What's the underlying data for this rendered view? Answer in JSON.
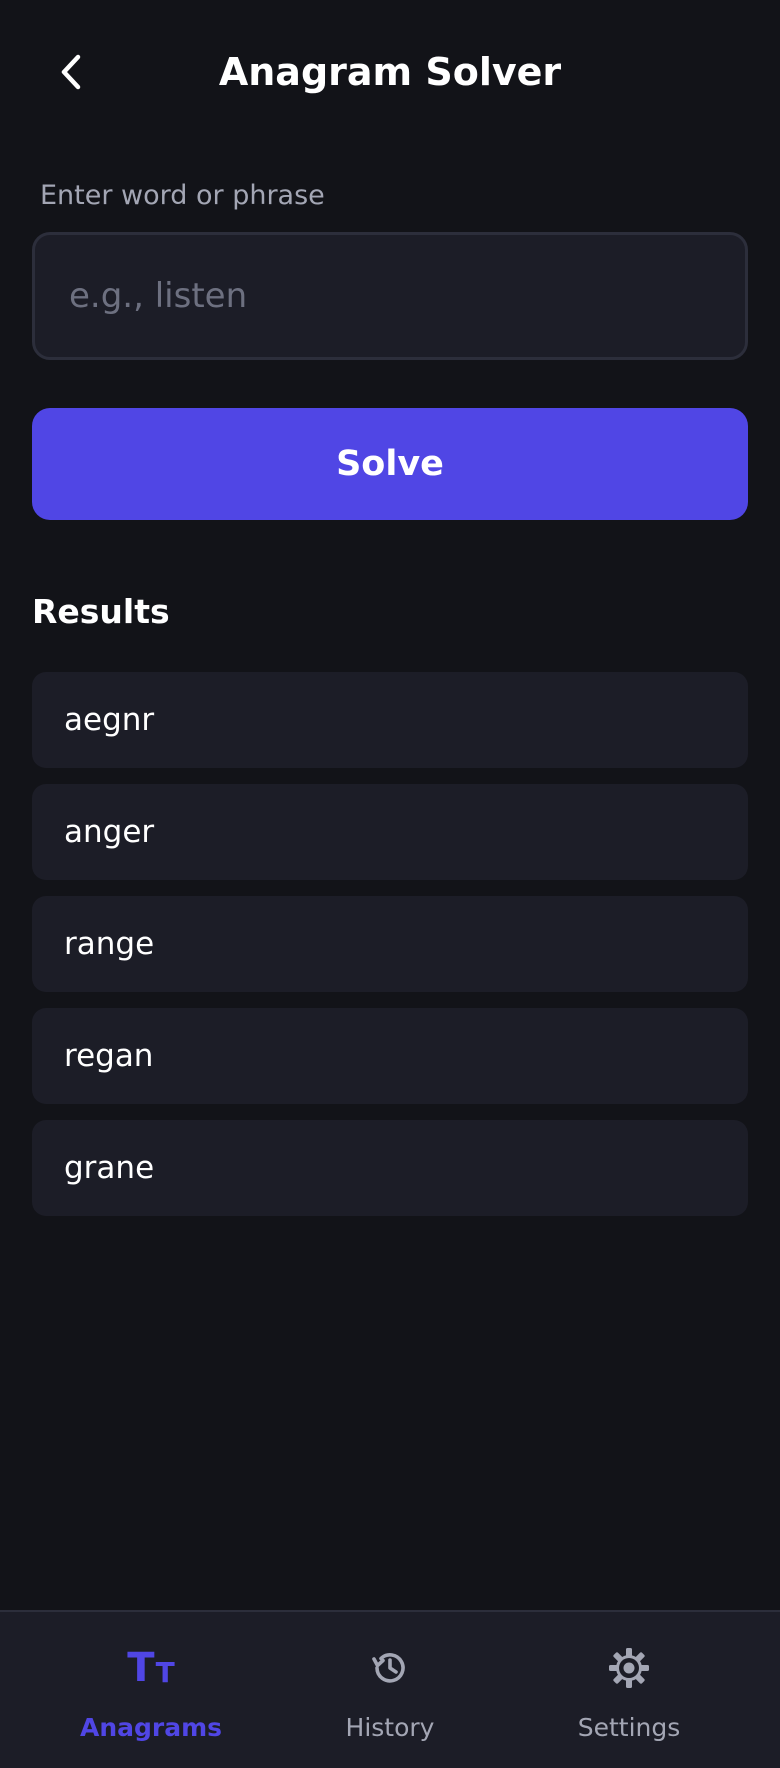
{
  "header": {
    "title": "Anagram Solver",
    "back_icon": "chevron-left-icon"
  },
  "form": {
    "label": "Enter word or phrase",
    "input_value": "",
    "placeholder": "e.g., listen",
    "solve_label": "Solve"
  },
  "results": {
    "heading": "Results",
    "items": [
      {
        "word": "aegnr"
      },
      {
        "word": "anger"
      },
      {
        "word": "range"
      },
      {
        "word": "regan"
      },
      {
        "word": "grane"
      }
    ]
  },
  "nav": {
    "items": [
      {
        "label": "Anagrams",
        "icon": "text-size-icon",
        "active": true
      },
      {
        "label": "History",
        "icon": "history-icon",
        "active": false
      },
      {
        "label": "Settings",
        "icon": "gear-icon",
        "active": false
      }
    ]
  },
  "colors": {
    "background": "#121318",
    "surface": "#1c1d27",
    "accent": "#5046e5",
    "muted_text": "#a3a6b4"
  }
}
